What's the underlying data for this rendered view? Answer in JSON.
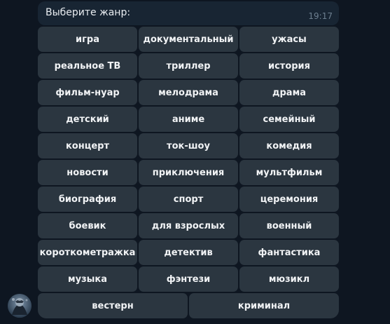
{
  "message": {
    "text": "Выберите жанр:",
    "time": "19:17"
  },
  "keyboard": {
    "rows": [
      [
        "игра",
        "документальный",
        "ужасы"
      ],
      [
        "реальное ТВ",
        "триллер",
        "история"
      ],
      [
        "фильм-нуар",
        "мелодрама",
        "драма"
      ],
      [
        "детский",
        "аниме",
        "семейный"
      ],
      [
        "концерт",
        "ток-шоу",
        "комедия"
      ],
      [
        "новости",
        "приключения",
        "мультфильм"
      ],
      [
        "биография",
        "спорт",
        "церемония"
      ],
      [
        "боевик",
        "для взрослых",
        "военный"
      ],
      [
        "короткометражка",
        "детектив",
        "фантастика"
      ],
      [
        "музыка",
        "фэнтези",
        "мюзикл"
      ],
      [
        "вестерн",
        "криминал"
      ]
    ]
  },
  "avatar": {
    "icon": "bot-avatar-icon"
  },
  "colors": {
    "background": "#0e1621",
    "message_bubble": "#182533",
    "button": "#2b3640",
    "text": "#f1f3f5",
    "time": "#6d7f8f"
  }
}
